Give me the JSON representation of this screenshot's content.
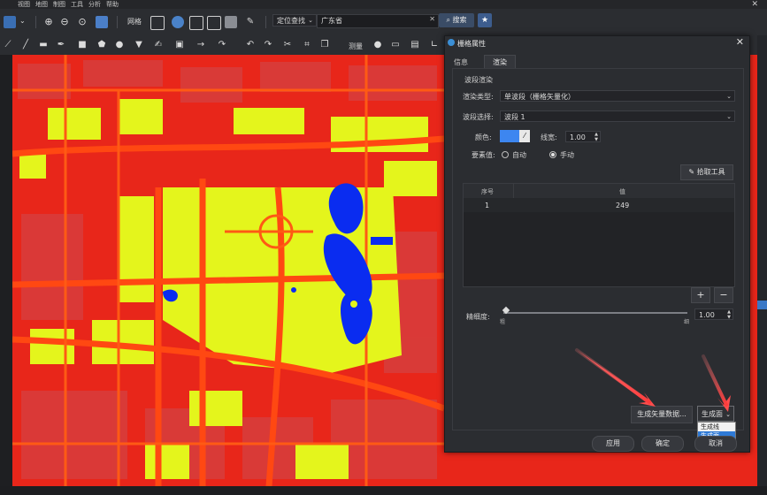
{
  "menubar": {
    "items": [
      "视图",
      "地图",
      "制图",
      "工具",
      "分析",
      "帮助"
    ]
  },
  "toolbar": {
    "grid_label": "网格",
    "search_type": "定位查找",
    "search_value": "广东省",
    "search_button": "搜索",
    "measure_label": "测量"
  },
  "dialog": {
    "title": "栅格属性",
    "tabs": {
      "info": "信息",
      "render": "渲染"
    },
    "group_title": "波段渲染",
    "render_type": {
      "label": "渲染类型:",
      "value": "单波段（栅格矢量化）"
    },
    "band_select": {
      "label": "波段选择:",
      "value": "波段 1"
    },
    "color": {
      "label": "颜色:",
      "hex": "#3d86f0"
    },
    "line_width": {
      "label": "线宽:",
      "value": "1.00"
    },
    "element_value": {
      "label": "要素值:",
      "options": [
        "自动",
        "手动"
      ],
      "selected": "手动"
    },
    "pick_tool": "拾取工具",
    "table": {
      "headers": [
        "序号",
        "值"
      ],
      "rows": [
        {
          "index": "1",
          "value": "249"
        }
      ]
    },
    "add_button": "+",
    "remove_button": "−",
    "fineness": {
      "label": "精细度:",
      "value": "1.00",
      "min_mark": "粗",
      "max_mark": "细"
    },
    "gen_vector_button": "生成矢量数据...",
    "gen_type": {
      "value": "生成面",
      "options": [
        "生成线",
        "生成面"
      ],
      "selected": "生成面"
    },
    "apply": "应用",
    "ok": "确定",
    "cancel": "取消"
  },
  "map_colors": {
    "background": "#e8261a",
    "roads": "#ff4a10",
    "vegetation": "#e4f51c",
    "water": "#0a2cf0",
    "buildings": "#d83a3a"
  },
  "accent_color": "#3a78c6"
}
